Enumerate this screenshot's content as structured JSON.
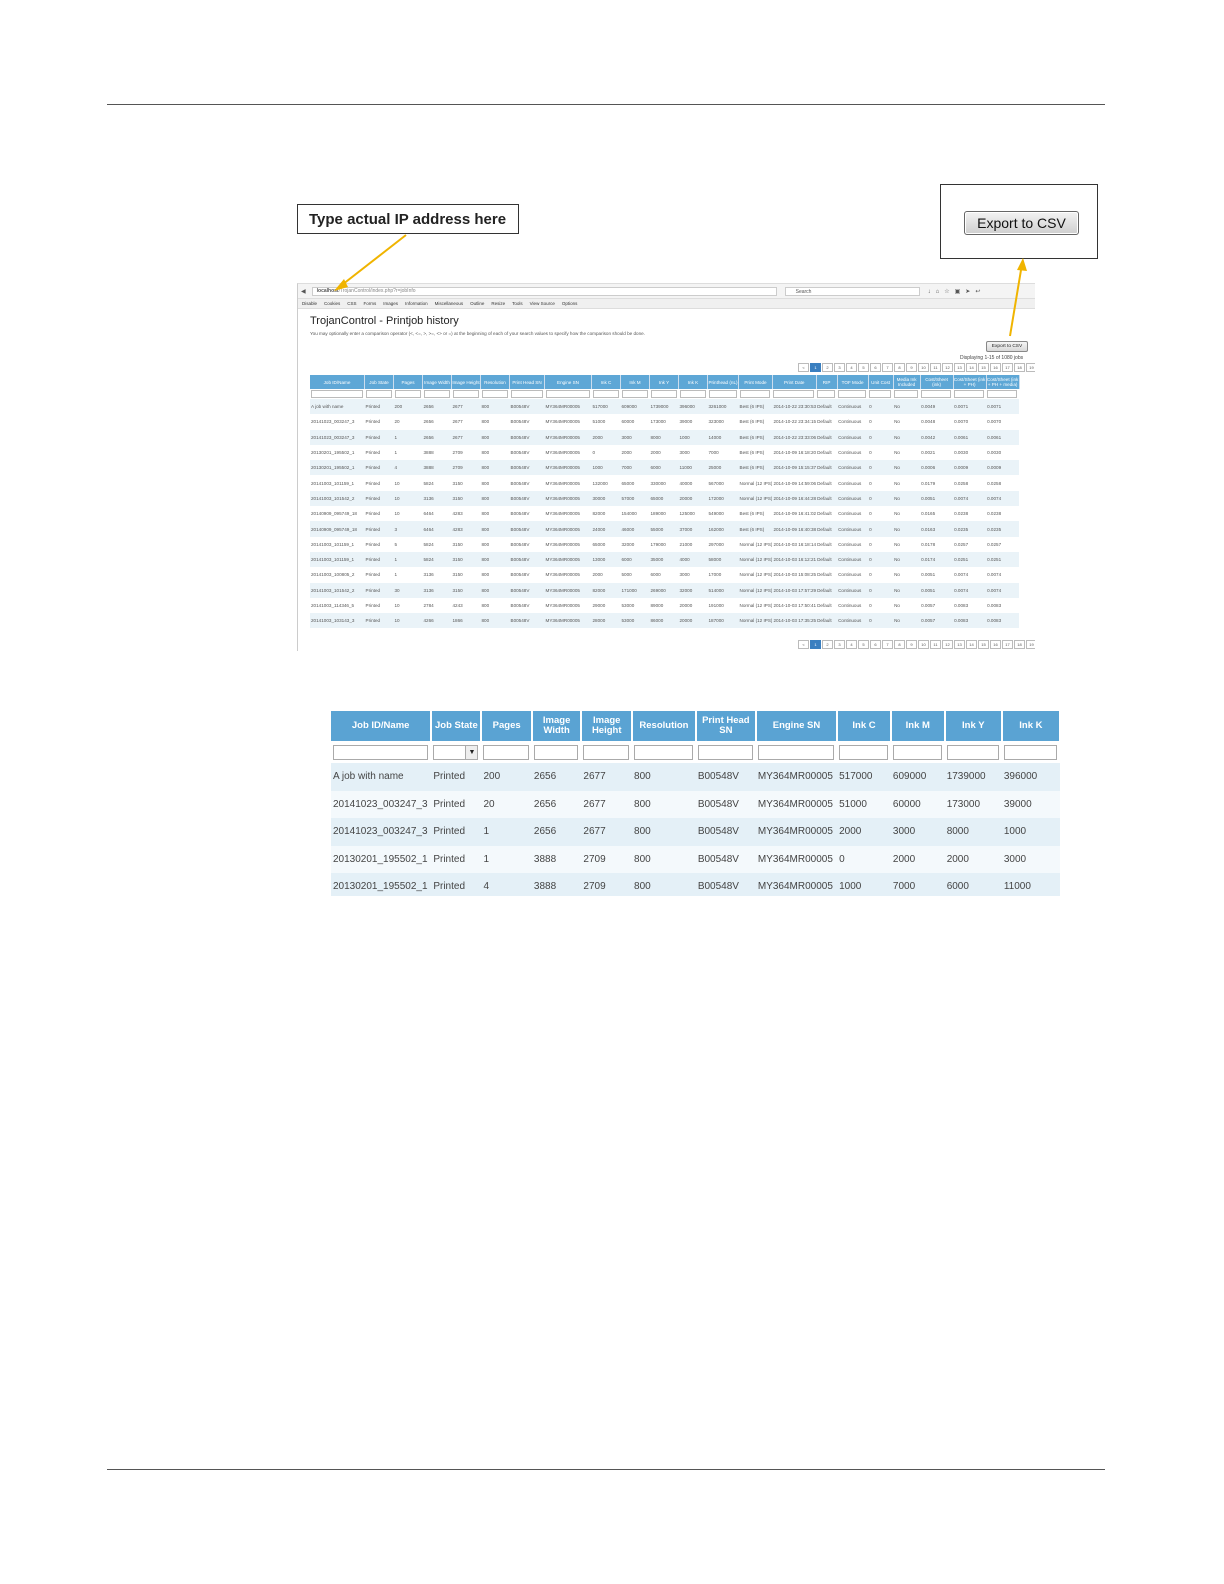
{
  "callouts": {
    "ip_label": "Type actual IP address here",
    "export_label": "Export to CSV"
  },
  "browser": {
    "url_host": "localhost",
    "url_path": "/TrojanControl/index.php?r=jobInfo",
    "search_placeholder": "Search",
    "toolbar_items": [
      "Disable",
      "Cookies",
      "CSS",
      "Forms",
      "Images",
      "Information",
      "Miscellaneous",
      "Outline",
      "Resize",
      "Tools",
      "View Source",
      "Options"
    ]
  },
  "app": {
    "title": "TrojanControl - Printjob history",
    "hint": "You may optionally enter a comparison operator (<, <=, >, >=, <> or =) at the beginning of each of your search values to specify how the comparison should be done.",
    "export_button": "Export to CSV",
    "displaying": "Displaying 1-15 of 1080 jobs",
    "pager_top": [
      "<",
      "1",
      "2",
      "3",
      "4",
      "5",
      "6",
      "7",
      "8",
      "9",
      "10",
      "11",
      "12",
      "13",
      "14",
      "15",
      "16",
      "17",
      "18",
      "19",
      "20",
      ">"
    ],
    "pager_bottom": [
      "<",
      "1",
      "2",
      "3",
      "4",
      "5",
      "6",
      "7",
      "8",
      "9",
      "10",
      "11",
      "12",
      "13",
      "14",
      "15",
      "16",
      "17",
      "18",
      "19",
      "20",
      ">"
    ]
  },
  "mini_table": {
    "headers": [
      "Job ID/Name",
      "Job State",
      "Pages",
      "Image Width",
      "Image Height",
      "Resolution",
      "Print Head SN",
      "Engine SN",
      "Ink C",
      "Ink M",
      "Ink Y",
      "Ink K",
      "Printhead (nL)",
      "Print Mode",
      "Print Date",
      "RIP",
      "TOF Mode",
      "Unit Cost",
      "Media Ink Included",
      "Cost/Sheet (ink)",
      "Cost/Sheet (ink + PH)",
      "Cost/Sheet (ink + PH + media)"
    ],
    "rows": [
      [
        "A job with name",
        "Printed",
        "200",
        "2656",
        "2677",
        "800",
        "B00548V",
        "MY364MR00005",
        "517000",
        "609000",
        "1739000",
        "396000",
        "3261000",
        "Best (6 IPS)",
        "2014-10-22 23:30:53",
        "Default",
        "Continuous",
        "0",
        "No",
        "0.0049",
        "0.0071",
        "0.0071"
      ],
      [
        "20141023_003247_3",
        "Printed",
        "20",
        "2656",
        "2677",
        "800",
        "B00548V",
        "MY364MR00005",
        "51000",
        "60000",
        "173000",
        "39000",
        "323000",
        "Best (6 IPS)",
        "2014-10-22 23:34:15",
        "Default",
        "Continuous",
        "0",
        "No",
        "0.0048",
        "0.0070",
        "0.0070"
      ],
      [
        "20141023_003247_3",
        "Printed",
        "1",
        "2656",
        "2677",
        "800",
        "B00548V",
        "MY364MR00005",
        "2000",
        "3000",
        "8000",
        "1000",
        "14000",
        "Best (6 IPS)",
        "2014-10-22 23:33:06",
        "Default",
        "Continuous",
        "0",
        "No",
        "0.0042",
        "0.0061",
        "0.0061"
      ],
      [
        "20130201_195502_1",
        "Printed",
        "1",
        "3888",
        "2709",
        "800",
        "B00548V",
        "MY364MR00005",
        "0",
        "2000",
        "2000",
        "3000",
        "7000",
        "Best (6 IPS)",
        "2014-10-09 16:18:20",
        "Default",
        "Continuous",
        "0",
        "No",
        "0.0021",
        "0.0030",
        "0.0030"
      ],
      [
        "20130201_195502_1",
        "Printed",
        "4",
        "3888",
        "2709",
        "800",
        "B00548V",
        "MY364MR00005",
        "1000",
        "7000",
        "6000",
        "11000",
        "25000",
        "Best (6 IPS)",
        "2014-10-09 15:15:37",
        "Default",
        "Continuous",
        "0",
        "No",
        "0.0006",
        "0.0009",
        "0.0009"
      ],
      [
        "20141003_101159_1",
        "Printed",
        "10",
        "5824",
        "3150",
        "800",
        "B00548V",
        "MY364MR00005",
        "132000",
        "65000",
        "330000",
        "40000",
        "567000",
        "Normal (12 IPS)",
        "2014-10-09 14:59:06",
        "Default",
        "Continuous",
        "0",
        "No",
        "0.0179",
        "0.0258",
        "0.0258"
      ],
      [
        "20141003_101542_2",
        "Printed",
        "10",
        "3136",
        "3150",
        "800",
        "B00548V",
        "MY364MR00005",
        "30000",
        "57000",
        "65000",
        "20000",
        "172000",
        "Normal (12 IPS)",
        "2014-10-09 16:44:28",
        "Default",
        "Continuous",
        "0",
        "No",
        "0.0051",
        "0.0074",
        "0.0074"
      ],
      [
        "20140909_095749_18",
        "Printed",
        "10",
        "6464",
        "4283",
        "800",
        "B00548V",
        "MY364MR00005",
        "82000",
        "154000",
        "189000",
        "125000",
        "549000",
        "Best (6 IPS)",
        "2014-10-09 16:41:02",
        "Default",
        "Continuous",
        "0",
        "No",
        "0.0165",
        "0.0238",
        "0.0238"
      ],
      [
        "20140909_095749_18",
        "Printed",
        "3",
        "6464",
        "4283",
        "800",
        "B00548V",
        "MY364MR00005",
        "24000",
        "46000",
        "55000",
        "37000",
        "162000",
        "Best (6 IPS)",
        "2014-10-09 16:40:38",
        "Default",
        "Continuous",
        "0",
        "No",
        "0.0163",
        "0.0235",
        "0.0235"
      ],
      [
        "20141003_101159_1",
        "Printed",
        "5",
        "5824",
        "3150",
        "800",
        "B00548V",
        "MY364MR00005",
        "65000",
        "32000",
        "179000",
        "21000",
        "297000",
        "Normal (12 IPS)",
        "2014-10-03 16:18:14",
        "Default",
        "Continuous",
        "0",
        "No",
        "0.0178",
        "0.0257",
        "0.0257"
      ],
      [
        "20141003_101159_1",
        "Printed",
        "1",
        "5824",
        "3150",
        "800",
        "B00548V",
        "MY364MR00005",
        "13000",
        "6000",
        "35000",
        "4000",
        "58000",
        "Normal (12 IPS)",
        "2014-10-03 16:12:21",
        "Default",
        "Continuous",
        "0",
        "No",
        "0.0174",
        "0.0251",
        "0.0251"
      ],
      [
        "20141003_100805_2",
        "Printed",
        "1",
        "3136",
        "3150",
        "800",
        "B00548V",
        "MY364MR00005",
        "2000",
        "5000",
        "6000",
        "3000",
        "17000",
        "Normal (12 IPS)",
        "2014-10-03 15:08:25",
        "Default",
        "Continuous",
        "0",
        "No",
        "0.0051",
        "0.0074",
        "0.0074"
      ],
      [
        "20141003_101542_2",
        "Printed",
        "30",
        "3136",
        "3150",
        "800",
        "B00548V",
        "MY364MR00005",
        "82000",
        "171000",
        "269000",
        "32000",
        "514000",
        "Normal (12 IPS)",
        "2014-10-03 17:57:29",
        "Default",
        "Continuous",
        "0",
        "No",
        "0.0051",
        "0.0074",
        "0.0074"
      ],
      [
        "20141003_114346_5",
        "Printed",
        "10",
        "2784",
        "4243",
        "800",
        "B00548V",
        "MY364MR00005",
        "29000",
        "53000",
        "89000",
        "20000",
        "191000",
        "Normal (12 IPS)",
        "2014-10-03 17:50:41",
        "Default",
        "Continuous",
        "0",
        "No",
        "0.0057",
        "0.0083",
        "0.0083"
      ],
      [
        "20141003_103143_3",
        "Printed",
        "10",
        "4266",
        "1866",
        "800",
        "B00548V",
        "MY364MR00005",
        "28000",
        "53000",
        "86000",
        "20000",
        "187000",
        "Normal (12 IPS)",
        "2014-10-03 17:35:25",
        "Default",
        "Continuous",
        "0",
        "No",
        "0.0057",
        "0.0083",
        "0.0083"
      ]
    ]
  },
  "big_table": {
    "headers": [
      "Job ID/Name",
      "Job State",
      "Pages",
      "Image Width",
      "Image Height",
      "Resolution",
      "Print Head SN",
      "Engine SN",
      "Ink C",
      "Ink M",
      "Ink Y",
      "Ink K"
    ],
    "rows": [
      [
        "A job with name",
        "Printed",
        "200",
        "2656",
        "2677",
        "800",
        "B00548V",
        "MY364MR00005",
        "517000",
        "609000",
        "1739000",
        "396000"
      ],
      [
        "20141023_003247_3",
        "Printed",
        "20",
        "2656",
        "2677",
        "800",
        "B00548V",
        "MY364MR00005",
        "51000",
        "60000",
        "173000",
        "39000"
      ],
      [
        "20141023_003247_3",
        "Printed",
        "1",
        "2656",
        "2677",
        "800",
        "B00548V",
        "MY364MR00005",
        "2000",
        "3000",
        "8000",
        "1000"
      ],
      [
        "20130201_195502_1",
        "Printed",
        "1",
        "3888",
        "2709",
        "800",
        "B00548V",
        "MY364MR00005",
        "0",
        "2000",
        "2000",
        "3000"
      ],
      [
        "20130201_195502_1",
        "Printed",
        "4",
        "3888",
        "2709",
        "800",
        "B00548V",
        "MY364MR00005",
        "1000",
        "7000",
        "6000",
        "11000"
      ]
    ]
  },
  "colors": {
    "header_blue": "#5aa3d3",
    "arrow": "#f0b400",
    "pager_active": "#3a7fc0"
  }
}
